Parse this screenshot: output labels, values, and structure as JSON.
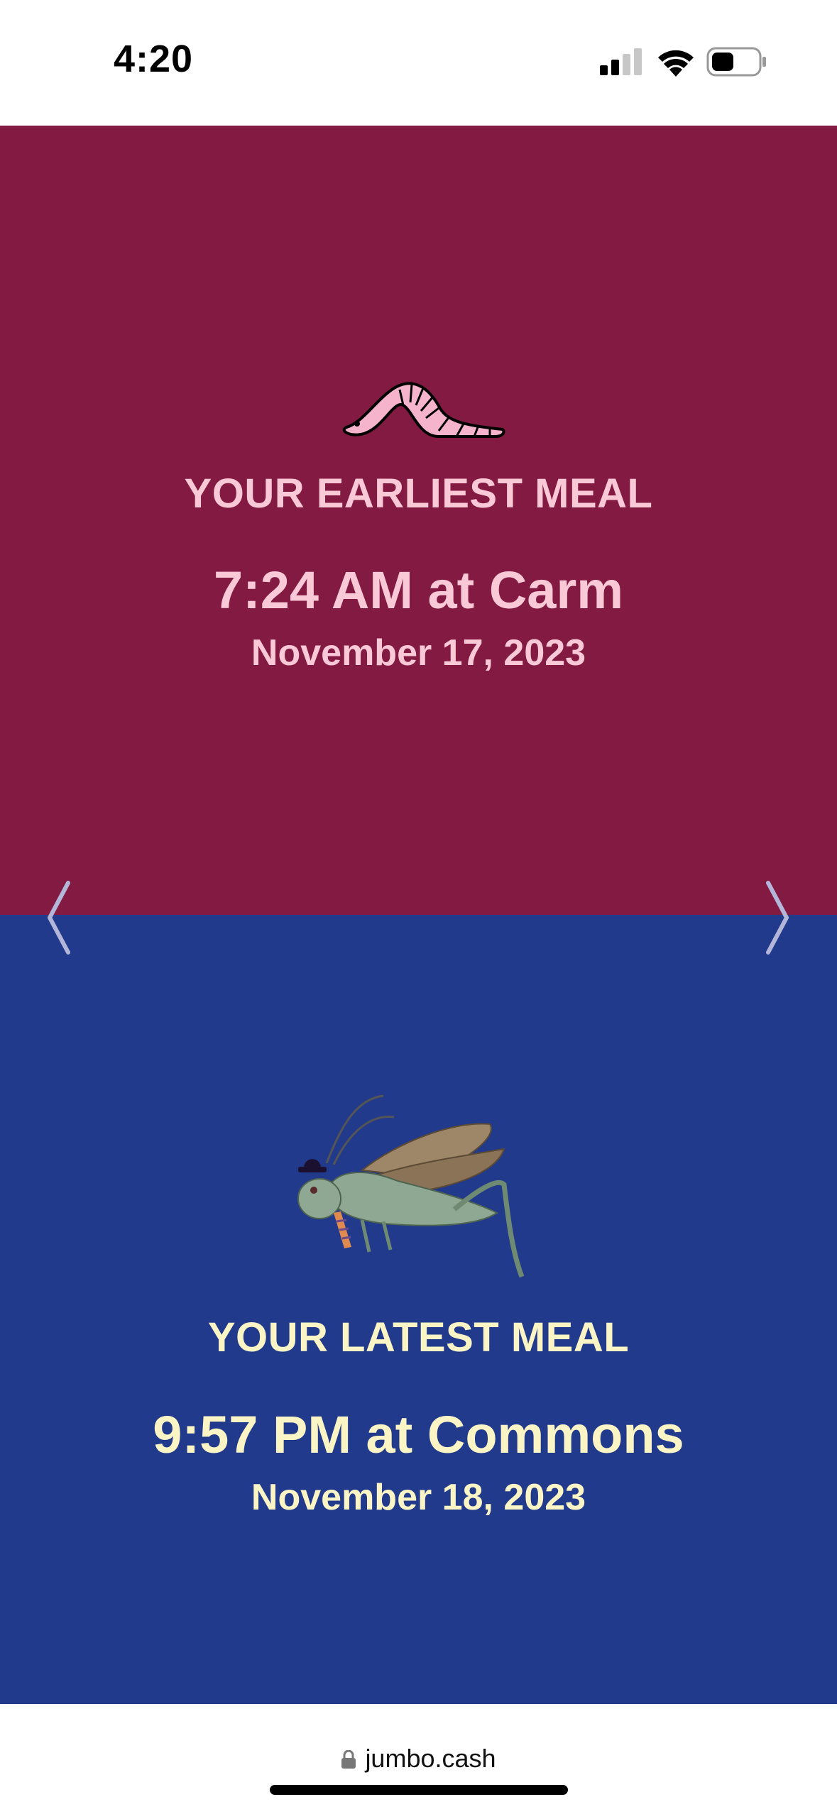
{
  "status_bar": {
    "time": "4:20",
    "icons": [
      "cellular-signal-icon",
      "wifi-icon",
      "battery-icon"
    ]
  },
  "earliest_meal": {
    "image": "worm-illustration",
    "heading": "YOUR EARLIEST MEAL",
    "time_location": "7:24 AM at Carm",
    "date": "November 17, 2023",
    "background_color": "#831a41",
    "text_color": "#f9c9d8"
  },
  "latest_meal": {
    "image": "grasshopper-in-hat-illustration",
    "heading": "YOUR LATEST MEAL",
    "time_location": "9:57 PM at Commons",
    "date": "November 18, 2023",
    "background_color": "#213a8c",
    "text_color": "#fbf5c6"
  },
  "navigation": {
    "prev_icon": "chevron-left-icon",
    "next_icon": "chevron-right-icon"
  },
  "browser": {
    "url": "jumbo.cash",
    "lock_icon": "lock-icon"
  }
}
